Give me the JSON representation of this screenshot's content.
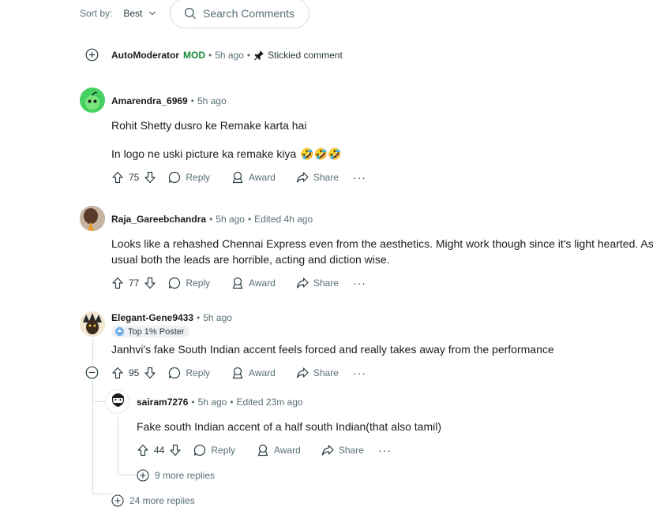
{
  "toolbar": {
    "sort_label": "Sort by:",
    "sort_value": "Best",
    "search_placeholder": "Search Comments"
  },
  "sticky": {
    "user": "AutoModerator",
    "mod_tag": "MOD",
    "time": "5h ago",
    "status": "Stickied comment"
  },
  "comments": [
    {
      "user": "Amarendra_6969",
      "time": "5h ago",
      "lines": [
        "Rohit Shetty dusro ke Remake karta hai",
        "In logo ne uski picture ka remake kiya"
      ],
      "emoji": "🤣🤣🤣",
      "votes": "75"
    },
    {
      "user": "Raja_Gareebchandra",
      "time": "5h ago",
      "edited": "Edited 4h ago",
      "lines": [
        "Looks like a rehashed Chennai Express even from the aesthetics. Might work though since it's light hearted. As",
        "usual both the leads are horrible, acting and diction wise."
      ],
      "votes": "77"
    },
    {
      "user": "Elegant-Gene9433",
      "time": "5h ago",
      "flair": "Top 1% Poster",
      "lines": [
        "Janhvi's fake South Indian accent feels forced and really takes away from the performance"
      ],
      "votes": "95"
    }
  ],
  "reply": {
    "user": "sairam7276",
    "time": "5h ago",
    "edited": "Edited 23m ago",
    "lines": [
      "Fake south Indian accent of a half south Indian(that also tamil)"
    ],
    "votes": "44",
    "more_replies": "9 more replies"
  },
  "thread_more_replies": "24 more replies",
  "labels": {
    "reply": "Reply",
    "award": "Award",
    "share": "Share",
    "dot": "•"
  },
  "colors": {
    "mod_green": "#178a37",
    "meta_gray": "#576f76",
    "thread_line": "#d5dbde"
  }
}
